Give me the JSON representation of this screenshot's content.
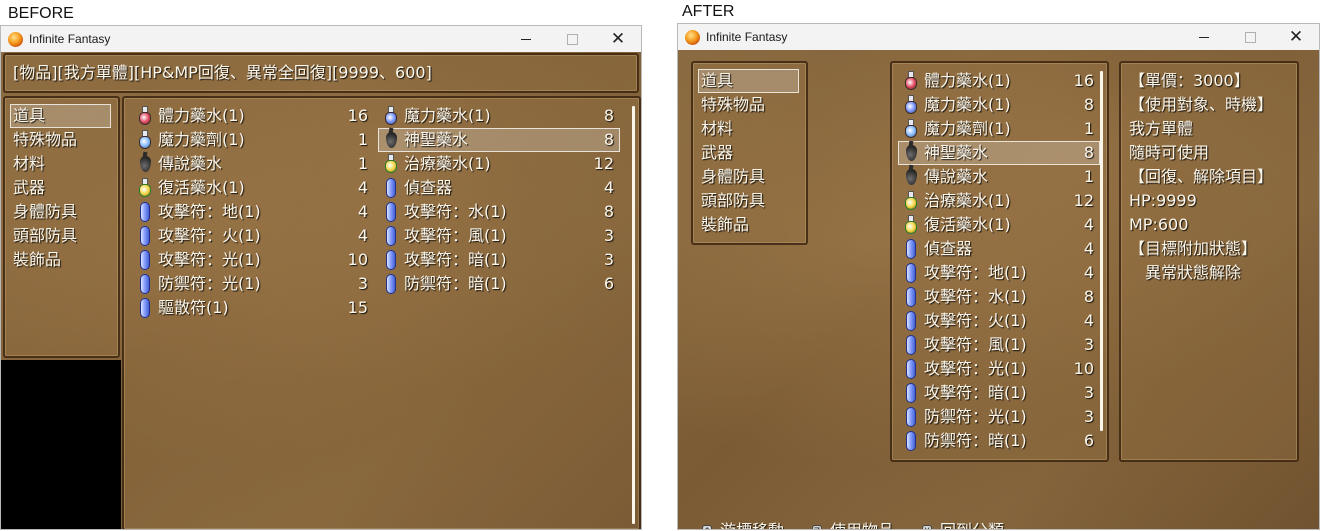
{
  "captions": {
    "before": "BEFORE",
    "after": "AFTER"
  },
  "window": {
    "title": "Infinite Fantasy"
  },
  "before": {
    "help": "[物品][我方單體][HP&MP回復、異常全回復][9999、600]",
    "categories": [
      "道具",
      "特殊物品",
      "材料",
      "武器",
      "身體防具",
      "頭部防具",
      "裝飾品"
    ],
    "selected_category": "道具",
    "items": [
      {
        "name": "體力藥水(1)",
        "count": "16",
        "icon": "red-potion-icon"
      },
      {
        "name": "魔力藥水(1)",
        "count": "8",
        "icon": "blue-potion-icon"
      },
      {
        "name": "魔力藥劑(1)",
        "count": "1",
        "icon": "blue-vial-icon"
      },
      {
        "name": "神聖藥水",
        "count": "8",
        "icon": "black-drop-icon"
      },
      {
        "name": "傳說藥水",
        "count": "1",
        "icon": "black-drop-icon"
      },
      {
        "name": "治療藥水(1)",
        "count": "12",
        "icon": "green-potion-icon"
      },
      {
        "name": "復活藥水(1)",
        "count": "4",
        "icon": "green-potion-icon"
      },
      {
        "name": "偵查器",
        "count": "4",
        "icon": "crystal-icon"
      },
      {
        "name": "攻擊符：地(1)",
        "count": "4",
        "icon": "crystal-icon"
      },
      {
        "name": "攻擊符：水(1)",
        "count": "8",
        "icon": "crystal-icon"
      },
      {
        "name": "攻擊符：火(1)",
        "count": "4",
        "icon": "crystal-icon"
      },
      {
        "name": "攻擊符：風(1)",
        "count": "3",
        "icon": "crystal-icon"
      },
      {
        "name": "攻擊符：光(1)",
        "count": "10",
        "icon": "crystal-icon"
      },
      {
        "name": "攻擊符：暗(1)",
        "count": "3",
        "icon": "crystal-icon"
      },
      {
        "name": "防禦符：光(1)",
        "count": "3",
        "icon": "crystal-icon"
      },
      {
        "name": "防禦符：暗(1)",
        "count": "6",
        "icon": "crystal-icon"
      },
      {
        "name": "驅散符(1)",
        "count": "15",
        "icon": "crystal-icon"
      }
    ],
    "selected_item": "神聖藥水"
  },
  "after": {
    "categories": [
      "道具",
      "特殊物品",
      "材料",
      "武器",
      "身體防具",
      "頭部防具",
      "裝飾品"
    ],
    "selected_category": "道具",
    "items": [
      {
        "name": "體力藥水(1)",
        "count": "16",
        "icon": "red-potion-icon"
      },
      {
        "name": "魔力藥水(1)",
        "count": "8",
        "icon": "blue-potion-icon"
      },
      {
        "name": "魔力藥劑(1)",
        "count": "1",
        "icon": "blue-vial-icon"
      },
      {
        "name": "神聖藥水",
        "count": "8",
        "icon": "black-drop-icon"
      },
      {
        "name": "傳說藥水",
        "count": "1",
        "icon": "black-drop-icon"
      },
      {
        "name": "治療藥水(1)",
        "count": "12",
        "icon": "green-potion-icon"
      },
      {
        "name": "復活藥水(1)",
        "count": "4",
        "icon": "green-potion-icon"
      },
      {
        "name": "偵查器",
        "count": "4",
        "icon": "crystal-icon"
      },
      {
        "name": "攻擊符：地(1)",
        "count": "4",
        "icon": "crystal-icon"
      },
      {
        "name": "攻擊符：水(1)",
        "count": "8",
        "icon": "crystal-icon"
      },
      {
        "name": "攻擊符：火(1)",
        "count": "4",
        "icon": "crystal-icon"
      },
      {
        "name": "攻擊符：風(1)",
        "count": "3",
        "icon": "crystal-icon"
      },
      {
        "name": "攻擊符：光(1)",
        "count": "10",
        "icon": "crystal-icon"
      },
      {
        "name": "攻擊符：暗(1)",
        "count": "3",
        "icon": "crystal-icon"
      },
      {
        "name": "防禦符：光(1)",
        "count": "3",
        "icon": "crystal-icon"
      },
      {
        "name": "防禦符：暗(1)",
        "count": "6",
        "icon": "crystal-icon"
      }
    ],
    "selected_item": "神聖藥水",
    "detail": [
      "【單價：3000】",
      "【使用對象、時機】",
      "我方單體",
      "隨時可使用",
      "【回復、解除項目】",
      "HP:9999",
      "MP:600",
      "【目標附加狀態】",
      "　異常狀態解除"
    ],
    "help_bar": [
      {
        "key": "⇕",
        "label": "游標移動"
      },
      {
        "key": "Z",
        "label": "使用物品"
      },
      {
        "key": "X",
        "label": "回到分類"
      }
    ]
  },
  "colors": {
    "parchment": "#7f5f37",
    "text": "#fbf6ea",
    "frame": "#3c2612"
  }
}
